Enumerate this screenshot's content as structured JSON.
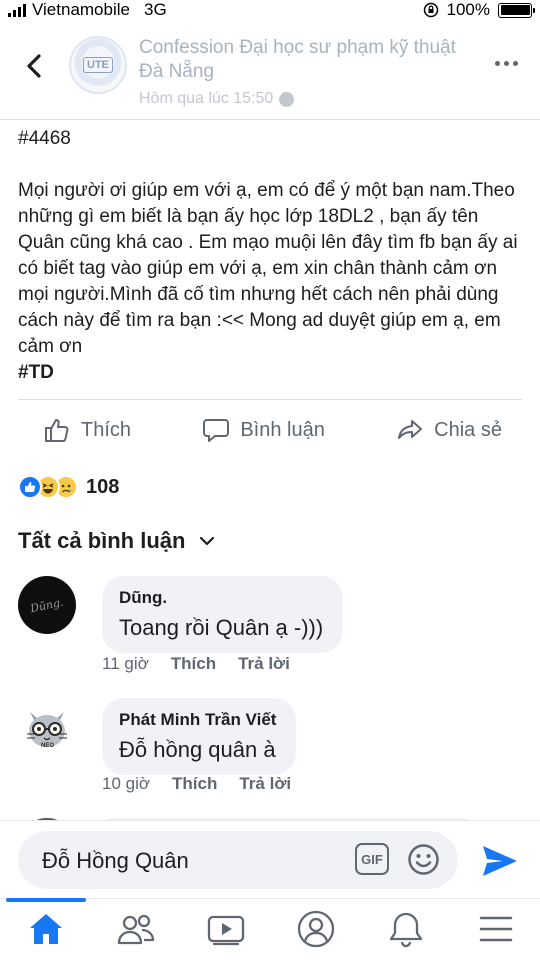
{
  "status_bar": {
    "carrier": "Vietnamobile",
    "network": "3G",
    "battery": "100%"
  },
  "header": {
    "page_name": "Confession Đại học sư phạm kỹ thuật Đà Nẵng",
    "avatar_label": "UTE",
    "time": "Hôm qua lúc 15:50"
  },
  "post": {
    "number": "#4468",
    "body": "Mọi người ơi giúp em với ạ, em có để ý một bạn nam.Theo những gì em biết là bạn ấy học lớp 18DL2 , bạn ấy tên Quân cũng khá cao . Em mạo muội lên đây tìm fb bạn ấy ai có biết tag vào giúp em với ạ, em xin chân thành cảm ơn mọi người.Mình đã cố tìm nhưng hết cách nên phải dùng cách này để tìm ra bạn :<< Mong ad duyệt giúp em ạ, em cảm ơn",
    "tag": "#TD"
  },
  "actions": {
    "like": "Thích",
    "comment": "Bình luận",
    "share": "Chia sẻ"
  },
  "reactions": {
    "count": "108",
    "types": [
      "like",
      "haha",
      "sad"
    ]
  },
  "comments_header": {
    "label": "Tất cả bình luận"
  },
  "comments": [
    {
      "avatar_text": "Dũng.",
      "name": "Dũng.",
      "text": "Toang rồi Quân ạ -)))",
      "time": "11 giờ",
      "like": "Thích",
      "reply": "Trả lời"
    },
    {
      "avatar_text": "NEO",
      "name": "Phát Minh Trần Viết",
      "text": "Đỗ hồng quân à",
      "time": "10 giờ",
      "like": "Thích",
      "reply": "Trả lời"
    }
  ],
  "composer": {
    "text": "Đỗ Hồng Quân",
    "gif_label": "GIF"
  },
  "tabs": [
    "home-icon",
    "friends-icon",
    "watch-icon",
    "profile-icon",
    "notifications-icon",
    "menu-icon"
  ],
  "colors": {
    "accent": "#1877f2",
    "text": "#1c1e21",
    "muted": "#606770",
    "bubble": "#f0f2f5"
  }
}
